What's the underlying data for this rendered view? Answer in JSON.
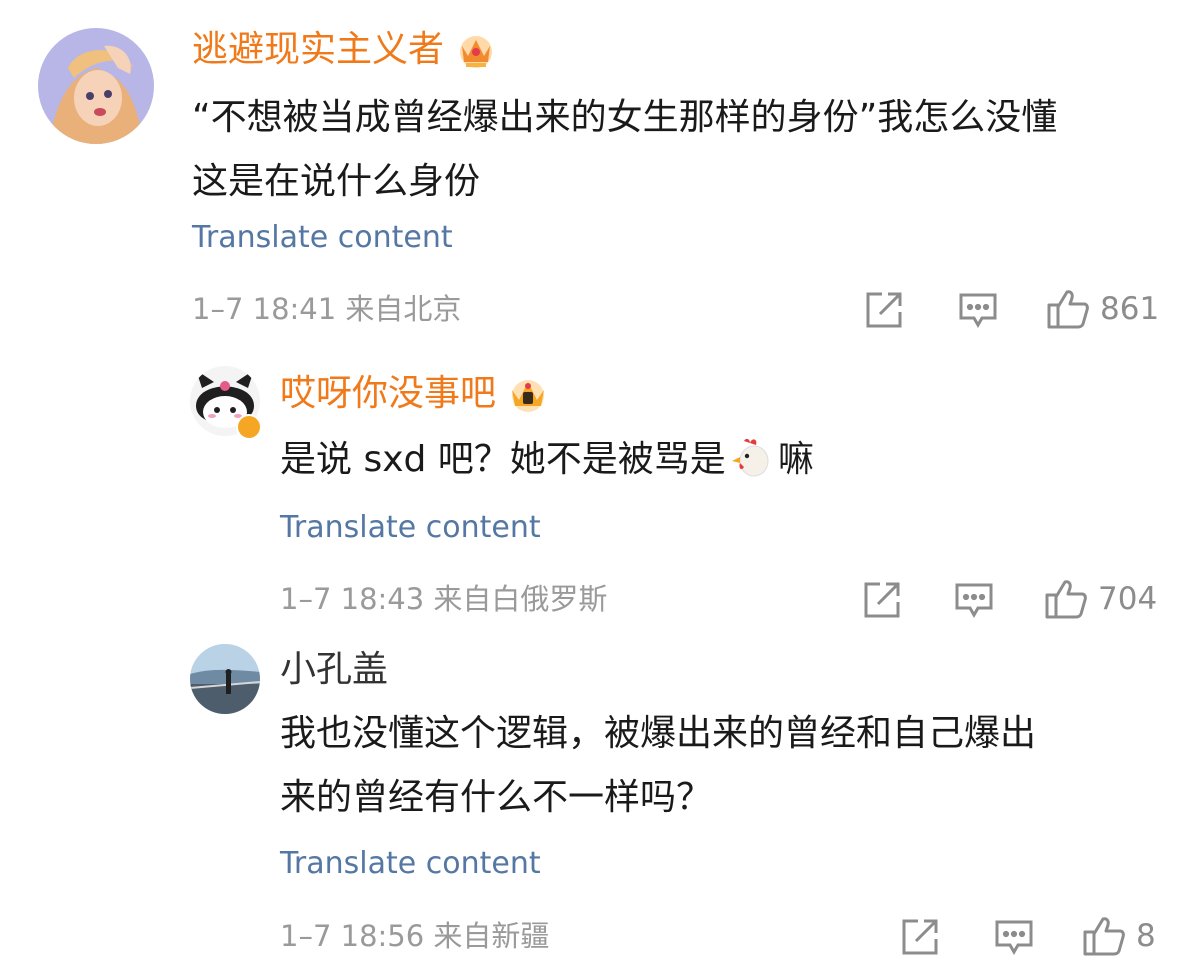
{
  "comments": [
    {
      "username": "逃避现实主义者",
      "text_lines": [
        "“不想被当成曾经爆出来的女生那样的身份”我怎么没懂",
        "这是在说什么身份"
      ],
      "translate_label": "Translate content",
      "meta": "1–7 18:41 来自北京",
      "likes": "861",
      "badge_icon": "crown-icon"
    },
    {
      "username": "哎呀你没事吧",
      "text_before": "是说 sxd 吧？她不是被骂是",
      "text_after": "嘛",
      "translate_label": "Translate content",
      "meta": "1–7 18:43 来自白俄罗斯",
      "likes": "704",
      "badge_icon": "crown-icon",
      "emoji_icon": "chicken-icon"
    },
    {
      "username": "小孔盖",
      "text_lines": [
        "我也没懂这个逻辑，被爆出来的曾经和自己爆出",
        "来的曾经有什么不一样吗？"
      ],
      "translate_label": "Translate content",
      "meta": "1–7 18:56 来自新疆",
      "likes": "8"
    }
  ],
  "colors": {
    "vip_name": "#f07a1a",
    "link": "#5577a3",
    "meta": "#9a9a9a",
    "icon": "#8c8c8c"
  }
}
